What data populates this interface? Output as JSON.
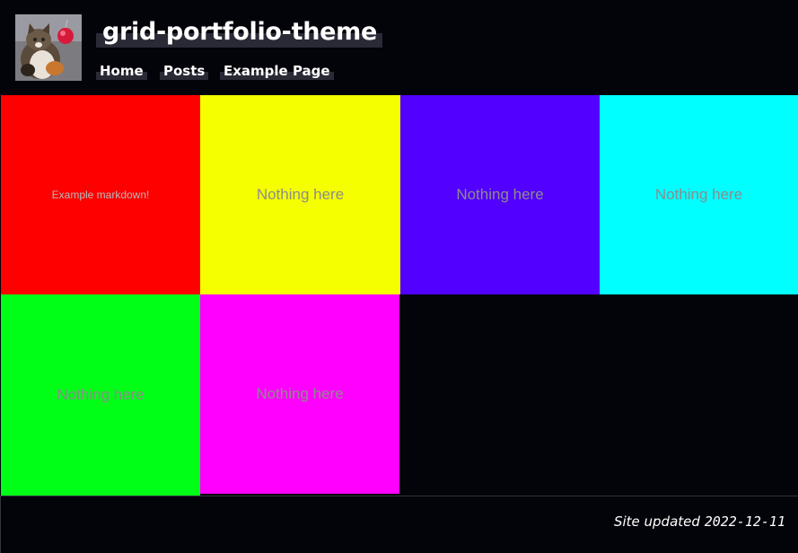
{
  "header": {
    "site_title": "grid-portfolio-theme",
    "avatar_icon": "cat-with-red-ornament-photo"
  },
  "nav": {
    "items": [
      {
        "label": "Home"
      },
      {
        "label": "Posts"
      },
      {
        "label": "Example Page"
      }
    ]
  },
  "grid": {
    "tiles": [
      {
        "label": "Example markdown!",
        "color": "#ff0000"
      },
      {
        "label": "Nothing here",
        "color": "#f5ff00"
      },
      {
        "label": "Nothing here",
        "color": "#5200ff"
      },
      {
        "label": "Nothing here",
        "color": "#00ffff"
      },
      {
        "label": "Nothing here",
        "color": "#00ff17"
      },
      {
        "label": "Nothing here",
        "color": "#ff00ff"
      }
    ]
  },
  "footer": {
    "prefix": "Site updated",
    "date": "2022-12-11"
  },
  "colors": {
    "background": "#03030a",
    "nav_highlight": "#2a2a36"
  }
}
